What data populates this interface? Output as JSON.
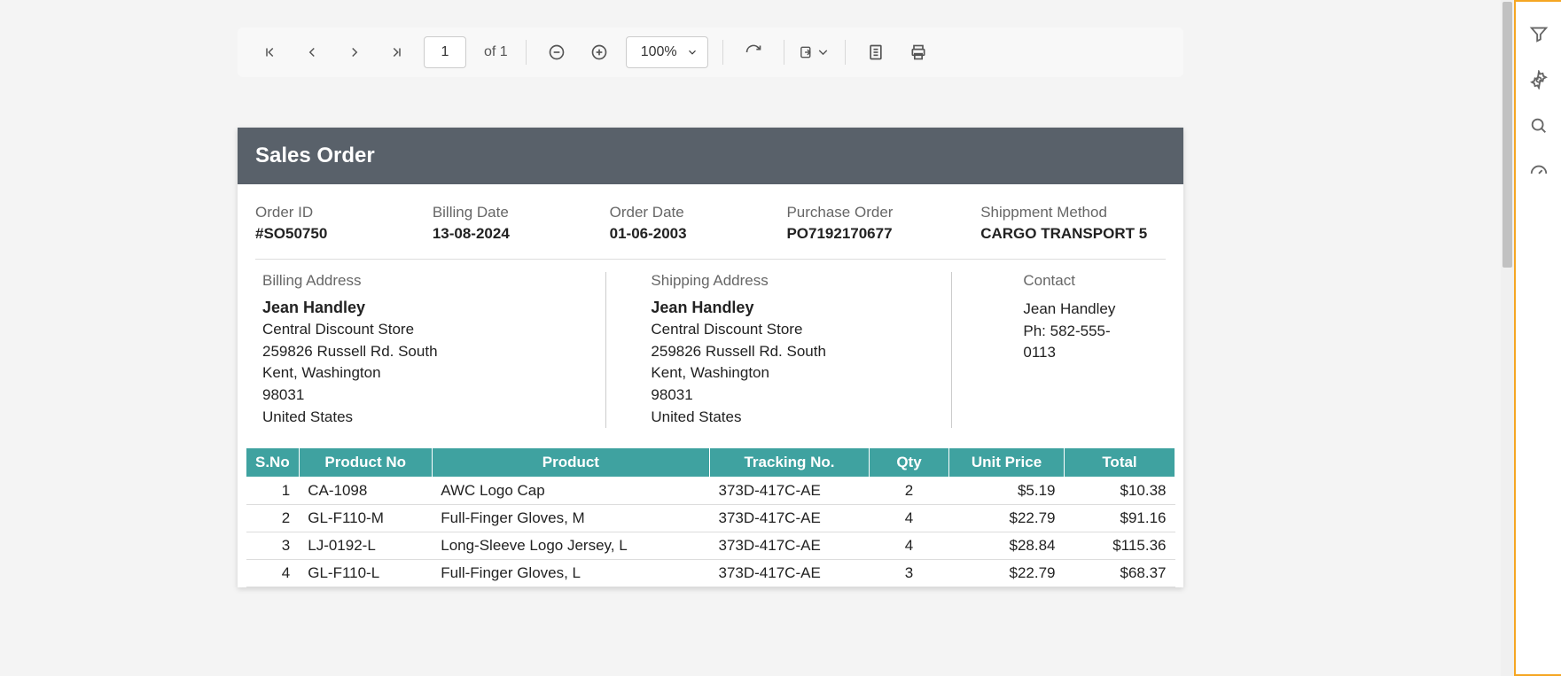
{
  "toolbar": {
    "page_current": "1",
    "page_of_prefix": "of ",
    "page_total": "1",
    "zoom": "100%"
  },
  "sidepanel": {
    "icons": [
      "filter",
      "settings",
      "search",
      "performance"
    ]
  },
  "doc": {
    "title": "Sales Order",
    "meta": {
      "order_id_label": "Order ID",
      "order_id": "#SO50750",
      "billing_date_label": "Billing Date",
      "billing_date": "13-08-2024",
      "order_date_label": "Order Date",
      "order_date": "01-06-2003",
      "po_label": "Purchase Order",
      "po": "PO7192170677",
      "shipment_label": "Shippment Method",
      "shipment": "CARGO TRANSPORT 5"
    },
    "billing": {
      "title": "Billing Address",
      "name": "Jean Handley",
      "line1": "Central Discount Store",
      "line2": "259826 Russell Rd. South",
      "line3": "Kent, Washington",
      "line4": "98031",
      "line5": "United States"
    },
    "shipping": {
      "title": "Shipping Address",
      "name": "Jean Handley",
      "line1": "Central Discount Store",
      "line2": "259826 Russell Rd. South",
      "line3": "Kent, Washington",
      "line4": "98031",
      "line5": "United States"
    },
    "contact": {
      "title": "Contact",
      "name": "Jean Handley",
      "phone": "Ph: 582-555-0113"
    },
    "table": {
      "headers": {
        "sno": "S.No",
        "product_no": "Product No",
        "product": "Product",
        "tracking": "Tracking No.",
        "qty": "Qty",
        "unit_price": "Unit Price",
        "total": "Total"
      },
      "rows": [
        {
          "sno": "1",
          "product_no": "CA-1098",
          "product": "AWC Logo Cap",
          "tracking": "373D-417C-AE",
          "qty": "2",
          "unit_price": "$5.19",
          "total": "$10.38"
        },
        {
          "sno": "2",
          "product_no": "GL-F110-M",
          "product": "Full-Finger Gloves, M",
          "tracking": "373D-417C-AE",
          "qty": "4",
          "unit_price": "$22.79",
          "total": "$91.16"
        },
        {
          "sno": "3",
          "product_no": "LJ-0192-L",
          "product": "Long-Sleeve Logo Jersey, L",
          "tracking": "373D-417C-AE",
          "qty": "4",
          "unit_price": "$28.84",
          "total": "$115.36"
        },
        {
          "sno": "4",
          "product_no": "GL-F110-L",
          "product": "Full-Finger Gloves, L",
          "tracking": "373D-417C-AE",
          "qty": "3",
          "unit_price": "$22.79",
          "total": "$68.37"
        }
      ]
    }
  }
}
